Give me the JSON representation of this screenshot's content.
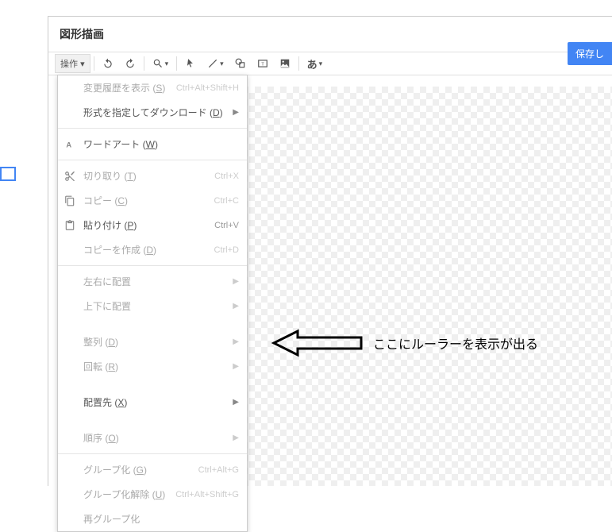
{
  "dialog_title": "図形描画",
  "save_button": "保存し",
  "toolbar": {
    "action_label": "操作",
    "action_caret": "▾"
  },
  "menu": {
    "items": [
      {
        "label": "変更履歴を表示",
        "key": "S",
        "shortcut": "Ctrl+Alt+Shift+H",
        "icon": "",
        "disabled": true,
        "arrow": false,
        "sep": false
      },
      {
        "label": "形式を指定してダウンロード",
        "key": "D",
        "shortcut": "",
        "icon": "",
        "disabled": false,
        "arrow": true,
        "sep": true
      },
      {
        "label": "ワードアート",
        "key": "W",
        "shortcut": "",
        "icon": "wordart",
        "disabled": false,
        "arrow": false,
        "sep": true
      },
      {
        "label": "切り取り",
        "key": "T",
        "shortcut": "Ctrl+X",
        "icon": "cut",
        "disabled": true,
        "arrow": false,
        "sep": false
      },
      {
        "label": "コピー",
        "key": "C",
        "shortcut": "Ctrl+C",
        "icon": "copy",
        "disabled": true,
        "arrow": false,
        "sep": false
      },
      {
        "label": "貼り付け",
        "key": "P",
        "shortcut": "Ctrl+V",
        "icon": "paste",
        "disabled": false,
        "arrow": false,
        "sep": false
      },
      {
        "label": "コピーを作成",
        "key": "D",
        "shortcut": "Ctrl+D",
        "icon": "",
        "disabled": true,
        "arrow": false,
        "sep": true
      },
      {
        "label": "左右に配置",
        "key": "",
        "shortcut": "",
        "icon": "",
        "disabled": true,
        "arrow": true,
        "sep": false
      },
      {
        "label": "上下に配置",
        "key": "",
        "shortcut": "",
        "icon": "",
        "disabled": true,
        "arrow": true,
        "sep": false
      },
      {
        "label": "整列",
        "key": "D",
        "shortcut": "",
        "icon": "",
        "disabled": true,
        "arrow": true,
        "sep": false
      },
      {
        "label": "回転",
        "key": "R",
        "shortcut": "",
        "icon": "",
        "disabled": true,
        "arrow": true,
        "sep": false
      },
      {
        "label": "配置先",
        "key": "X",
        "shortcut": "",
        "icon": "",
        "disabled": false,
        "arrow": true,
        "sep": false
      },
      {
        "label": "順序",
        "key": "O",
        "shortcut": "",
        "icon": "",
        "disabled": true,
        "arrow": true,
        "sep": true
      },
      {
        "label": "グループ化",
        "key": "G",
        "shortcut": "Ctrl+Alt+G",
        "icon": "",
        "disabled": true,
        "arrow": false,
        "sep": false
      },
      {
        "label": "グループ化解除",
        "key": "U",
        "shortcut": "Ctrl+Alt+Shift+G",
        "icon": "",
        "disabled": true,
        "arrow": false,
        "sep": false
      },
      {
        "label": "再グループ化",
        "key": "",
        "shortcut": "",
        "icon": "",
        "disabled": true,
        "arrow": false,
        "sep": false
      }
    ]
  },
  "annotation": "ここにルーラーを表示が出る"
}
